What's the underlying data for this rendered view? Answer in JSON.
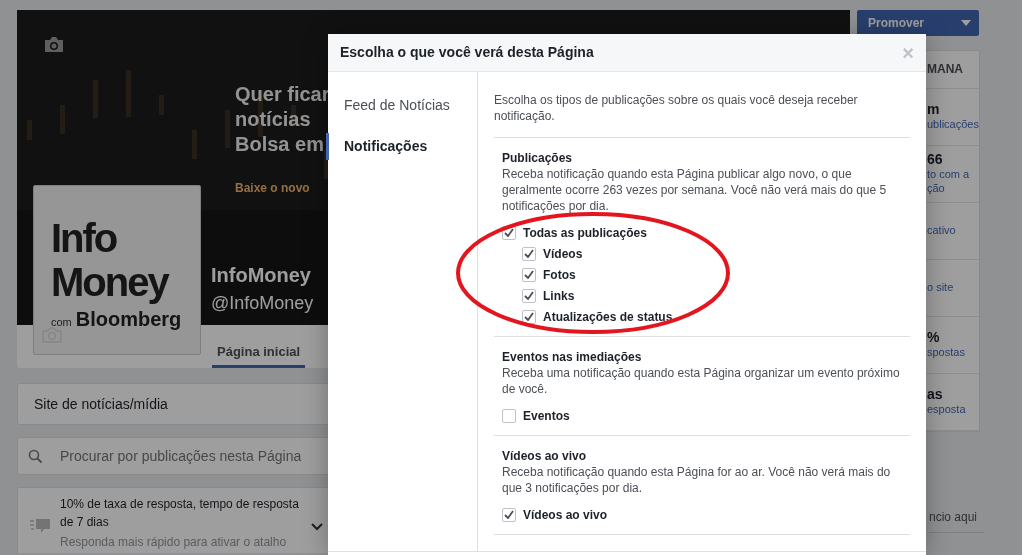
{
  "page": {
    "cover": {
      "lines": [
        "Quer ficar",
        "notícias",
        "Bolsa em"
      ],
      "cta": "Baixe o novo"
    },
    "profile": {
      "logo": [
        "Info",
        "Money",
        "com",
        "Bloomberg"
      ],
      "name": "InfoMoney",
      "handle": "@InfoMoney"
    },
    "tabs": [
      {
        "label": "Página inicial",
        "selected": true
      }
    ],
    "category": "Site de notícias/mídia",
    "search": {
      "placeholder": "Procurar por publicações nesta Página"
    },
    "response": {
      "title": "10% de taxa de resposta, tempo de resposta de 7 dias",
      "hint": "Responda mais rápido para ativar o atalho"
    }
  },
  "sidebar": {
    "promote_button": "Promover",
    "header": "MANA",
    "stats": [
      {
        "value": "m",
        "lines": [
          "ublicações"
        ]
      },
      {
        "value": "66",
        "lines": [
          "to com a",
          "ção"
        ]
      },
      {
        "lines": [
          "cativo"
        ]
      },
      {
        "lines": [
          "o site"
        ]
      },
      {
        "value": "%",
        "lines": [
          "spostas"
        ]
      },
      {
        "value": "as",
        "lines": [
          "esposta"
        ]
      }
    ],
    "footer_link": "ncio aqui"
  },
  "dialog": {
    "title": "Escolha o que você verá desta Página",
    "close": "×",
    "nav": [
      {
        "label": "Feed de Notícias",
        "selected": false
      },
      {
        "label": "Notificações",
        "selected": true
      }
    ],
    "intro": "Escolha os tipos de publicações sobre os quais você deseja receber notificação.",
    "sections": [
      {
        "title": "Publicações",
        "description": "Receba notificação quando esta Página publicar algo novo, o que geralmente ocorre 263 vezes por semana. Você não verá mais do que 5 notificações por dia.",
        "options": [
          {
            "label": "Todas as publicações",
            "checked": true,
            "children": [
              {
                "label": "Vídeos",
                "checked": true
              },
              {
                "label": "Fotos",
                "checked": true
              },
              {
                "label": "Links",
                "checked": true
              },
              {
                "label": "Atualizações de status",
                "checked": true
              }
            ]
          }
        ]
      },
      {
        "title": "Eventos nas imediações",
        "description": "Receba uma notificação quando esta Página organizar um evento próximo de você.",
        "options": [
          {
            "label": "Eventos",
            "checked": false
          }
        ]
      },
      {
        "title": "Vídeos ao vivo",
        "description": "Receba notificação quando esta Página for ao ar. Você não verá mais do que 3 notificações por dia.",
        "options": [
          {
            "label": "Vídeos ao vivo",
            "checked": true
          }
        ]
      }
    ]
  }
}
